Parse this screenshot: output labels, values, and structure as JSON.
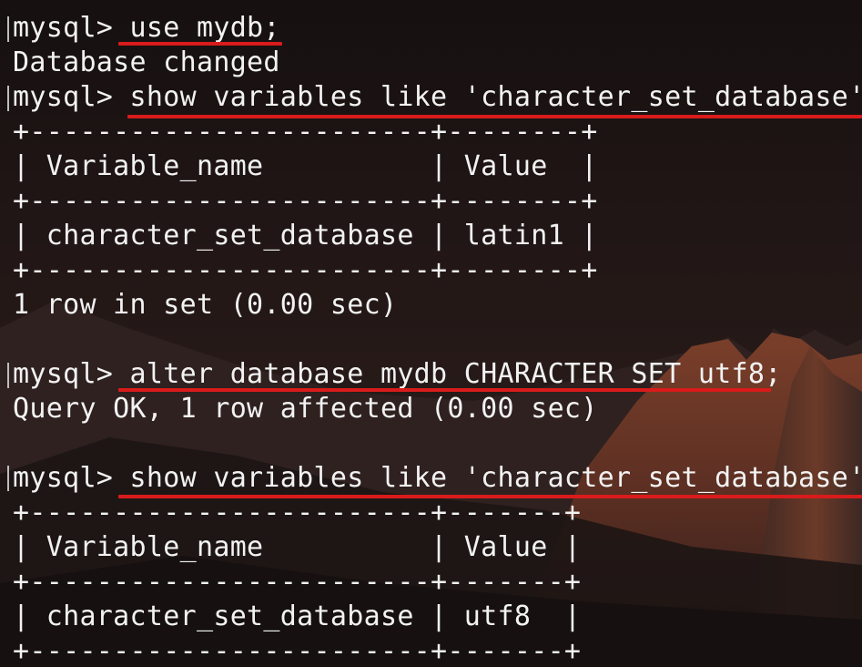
{
  "lines": [
    "mysql> use mydb;",
    "Database changed",
    "mysql> show variables like 'character_set_database';",
    "+------------------------+--------+",
    "| Variable_name          | Value  |",
    "+------------------------+--------+",
    "| character_set_database | latin1 |",
    "+------------------------+--------+",
    "1 row in set (0.00 sec)",
    "",
    "mysql> alter database mydb CHARACTER SET utf8;",
    "Query OK, 1 row affected (0.00 sec)",
    "",
    "mysql> show variables like 'character_set_database';",
    "+------------------------+-------+",
    "| Variable_name          | Value |",
    "+------------------------+-------+",
    "| character_set_database | utf8  |",
    "+------------------------+-------+"
  ],
  "colors": {
    "text": "#f2f2f2",
    "underline": "#d91b1b",
    "background": "#1c1514"
  }
}
